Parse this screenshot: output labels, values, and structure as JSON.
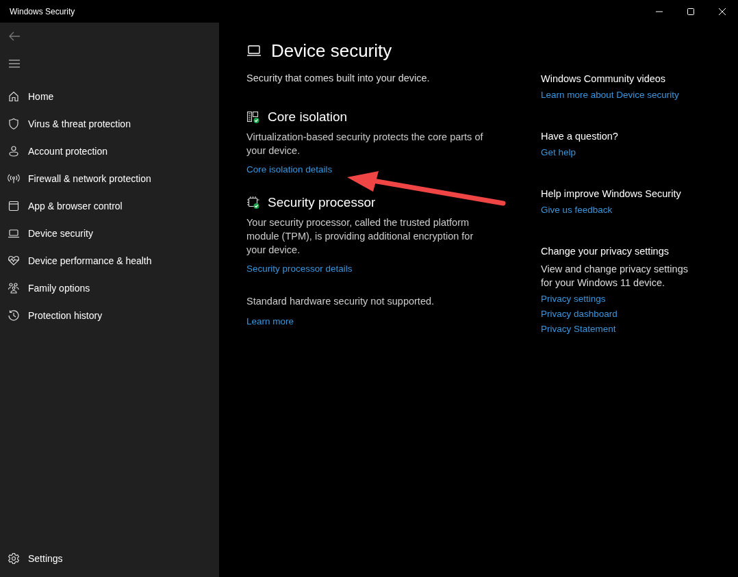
{
  "window": {
    "title": "Windows Security"
  },
  "sidebar": {
    "items": [
      {
        "label": "Home",
        "kind": "home"
      },
      {
        "label": "Virus & threat protection",
        "kind": "shield"
      },
      {
        "label": "Account protection",
        "kind": "person"
      },
      {
        "label": "Firewall & network protection",
        "kind": "antenna"
      },
      {
        "label": "App & browser control",
        "kind": "window"
      },
      {
        "label": "Device security",
        "kind": "laptop"
      },
      {
        "label": "Device performance & health",
        "kind": "heart"
      },
      {
        "label": "Family options",
        "kind": "family"
      },
      {
        "label": "Protection history",
        "kind": "history"
      }
    ],
    "settings": "Settings"
  },
  "page": {
    "title": "Device security",
    "subtitle": "Security that comes built into your device.",
    "sections": [
      {
        "kind": "core",
        "title": "Core isolation",
        "text": "Virtualization-based security protects the core parts of your device.",
        "link": "Core isolation details"
      },
      {
        "kind": "chip",
        "title": "Security processor",
        "text": "Your security processor, called the trusted platform module (TPM), is providing additional encryption for your device.",
        "link": "Security processor details"
      },
      {
        "kind": "plain",
        "text": "Standard hardware security not supported.",
        "link": "Learn more"
      }
    ]
  },
  "aside": [
    {
      "title": "Windows Community videos",
      "links": [
        "Learn more about Device security"
      ]
    },
    {
      "title": "Have a question?",
      "links": [
        "Get help"
      ]
    },
    {
      "title": "Help improve Windows Security",
      "links": [
        "Give us feedback"
      ]
    },
    {
      "title": "Change your privacy settings",
      "text": "View and change privacy settings for your Windows 11 device.",
      "links": [
        "Privacy settings",
        "Privacy dashboard",
        "Privacy Statement"
      ]
    }
  ]
}
